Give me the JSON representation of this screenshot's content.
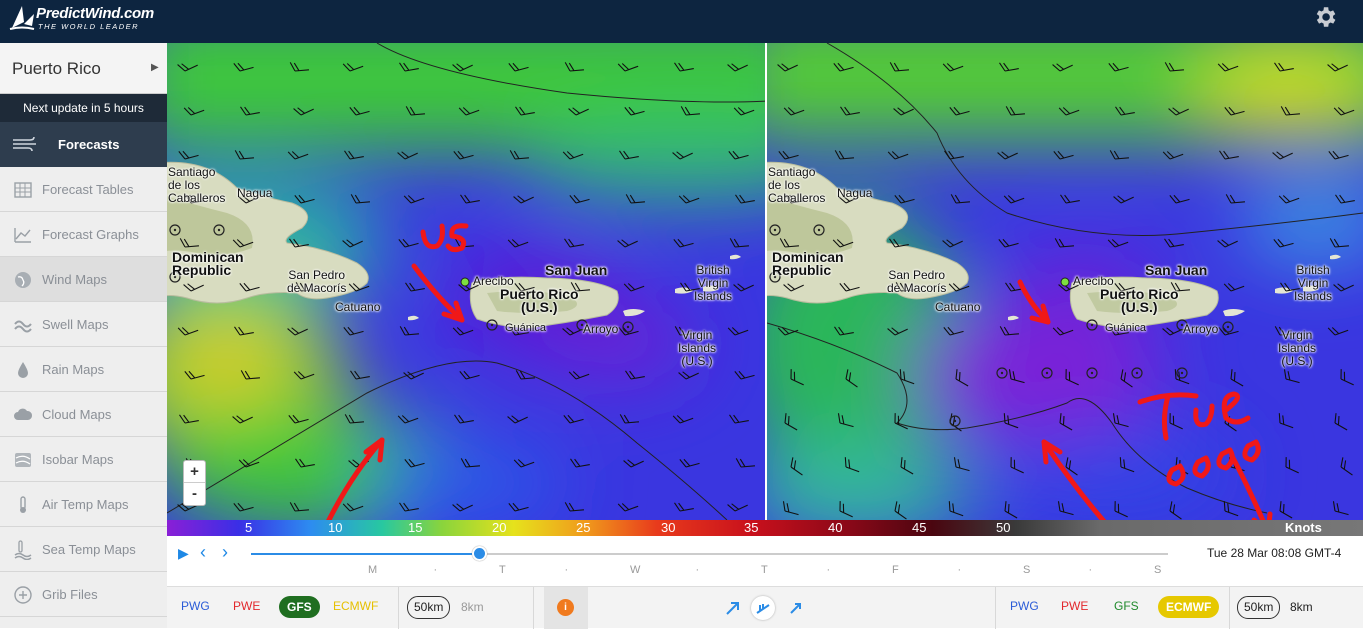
{
  "app": {
    "logo_title": "PredictWind.com",
    "logo_tagline": "THE WORLD LEADER",
    "settings_icon": "gear-icon"
  },
  "sidebar": {
    "location": "Puerto Rico",
    "next_update": "Next update in 5 hours",
    "section": {
      "label": "Forecasts",
      "icon": "wind-lines-icon"
    },
    "items": [
      {
        "label": "Forecast Tables",
        "icon": "table-icon"
      },
      {
        "label": "Forecast Graphs",
        "icon": "graph-icon"
      },
      {
        "label": "Wind Maps",
        "icon": "globe-icon",
        "active": true
      },
      {
        "label": "Swell Maps",
        "icon": "wave-icon"
      },
      {
        "label": "Rain Maps",
        "icon": "raindrop-icon"
      },
      {
        "label": "Cloud Maps",
        "icon": "cloud-icon"
      },
      {
        "label": "Isobar Maps",
        "icon": "isobar-icon"
      },
      {
        "label": "Air Temp Maps",
        "icon": "thermometer-icon"
      },
      {
        "label": "Sea Temp Maps",
        "icon": "sea-temp-icon"
      },
      {
        "label": "Grib Files",
        "icon": "grib-icon"
      }
    ]
  },
  "map": {
    "labels": {
      "santiago": "Santiago\nde los\nCaballeros",
      "nagua": "Nagua",
      "dominican_republic": "Dominican\nRepublic",
      "san_pedro": "San Pedro\nde Macorís",
      "catuano": "Catuano",
      "arecibo": "Arecibo",
      "san_juan": "San Juan",
      "puerto_rico": "Puerto Rico\n(U.S.)",
      "guanica": "Guánica",
      "arroyo": "Arroyo",
      "bvi": "British\nVirgin\nIslands",
      "usvi": "Virgin\nIslands\n(U.S.)"
    },
    "annotations": {
      "left_text": "us",
      "right_text_1": "Tue",
      "right_text_2": "0800"
    },
    "zoom_in": "+",
    "zoom_out": "-"
  },
  "scale": {
    "ticks": [
      "5",
      "10",
      "15",
      "20",
      "25",
      "30",
      "35",
      "40",
      "45",
      "50"
    ],
    "unit": "Knots"
  },
  "timeline": {
    "play_icon": "play-icon",
    "prev_icon": "chevron-left-icon",
    "next_icon": "chevron-right-icon",
    "days": [
      "M",
      "·",
      "T",
      "·",
      "W",
      "·",
      "T",
      "·",
      "F",
      "·",
      "S",
      "·",
      "S"
    ],
    "datetime": "Tue 28 Mar 08:08 GMT-4",
    "position_fraction": 0.25
  },
  "bottom": {
    "left_models": [
      "PWG",
      "PWE",
      "GFS",
      "ECMWF"
    ],
    "left_selected": "GFS",
    "left_res": [
      "50km",
      "8km"
    ],
    "info": "i",
    "right_models": [
      "PWG",
      "PWE",
      "GFS",
      "ECMWF"
    ],
    "right_selected": "ECMWF",
    "right_res": [
      "50km",
      "8km"
    ],
    "colors": {
      "PWG": "#2a5bd7",
      "PWE": "#e2282c",
      "GFS": "#1f8a2b",
      "ECMWF": "#e6c800"
    }
  }
}
